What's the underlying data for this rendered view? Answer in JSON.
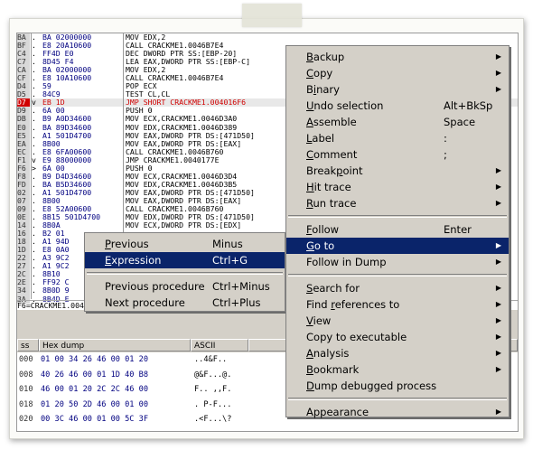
{
  "disassembly": {
    "rows": [
      {
        "addr": "BA",
        "mark": ".",
        "hex": "BA 02000000",
        "asm": "MOV EDX,2"
      },
      {
        "addr": "BF",
        "mark": ".",
        "hex": "E8 20A10600",
        "asm": "CALL CRACKME1.0046B7E4"
      },
      {
        "addr": "C4",
        "mark": ".",
        "hex": "FF4D E0",
        "asm": "DEC DWORD PTR SS:[EBP-20]"
      },
      {
        "addr": "C7",
        "mark": ".",
        "hex": "8D45 F4",
        "asm": "LEA EAX,DWORD PTR SS:[EBP-C]"
      },
      {
        "addr": "CA",
        "mark": ".",
        "hex": "BA 02000000",
        "asm": "MOV EDX,2"
      },
      {
        "addr": "CF",
        "mark": ".",
        "hex": "E8 10A10600",
        "asm": "CALL CRACKME1.0046B7E4"
      },
      {
        "addr": "D4",
        "mark": ".",
        "hex": "59",
        "asm": "POP ECX"
      },
      {
        "addr": "D5",
        "mark": ".",
        "hex": "84C9",
        "asm": "TEST CL,CL"
      },
      {
        "addr": "D7",
        "mark": "v",
        "hex": "EB 1D",
        "asm": "JMP SHORT CRACKME1.004016F6",
        "selected": true
      },
      {
        "addr": "D9",
        "mark": ".",
        "hex": "6A 00",
        "asm": "PUSH 0"
      },
      {
        "addr": "DB",
        "mark": ".",
        "hex": "B9 A0D34600",
        "asm": "MOV ECX,CRACKME1.0046D3A0"
      },
      {
        "addr": "E0",
        "mark": ".",
        "hex": "BA 89D34600",
        "asm": "MOV EDX,CRACKME1.0046D389"
      },
      {
        "addr": "E5",
        "mark": ".",
        "hex": "A1 501D4700",
        "asm": "MOV EAX,DWORD PTR DS:[471D50]"
      },
      {
        "addr": "EA",
        "mark": ".",
        "hex": "8B00",
        "asm": "MOV EAX,DWORD PTR DS:[EAX]"
      },
      {
        "addr": "EC",
        "mark": ".",
        "hex": "E8 6FA00600",
        "asm": "CALL CRACKME1.0046B760"
      },
      {
        "addr": "F1",
        "mark": "v",
        "hex": "E9 88000000",
        "asm": "JMP CRACKME1.0040177E"
      },
      {
        "addr": "F6",
        "mark": ">",
        "hex": "6A 00",
        "asm": "PUSH 0"
      },
      {
        "addr": "F8",
        "mark": ".",
        "hex": "B9 D4D34600",
        "asm": "MOV ECX,CRACKME1.0046D3D4"
      },
      {
        "addr": "FD",
        "mark": ".",
        "hex": "BA B5D34600",
        "asm": "MOV EDX,CRACKME1.0046D3B5"
      },
      {
        "addr": "02",
        "mark": ".",
        "hex": "A1 501D4700",
        "asm": "MOV EAX,DWORD PTR DS:[471D50]"
      },
      {
        "addr": "07",
        "mark": ".",
        "hex": "8B00",
        "asm": "MOV EAX,DWORD PTR DS:[EAX]"
      },
      {
        "addr": "09",
        "mark": ".",
        "hex": "E8 52A00600",
        "asm": "CALL CRACKME1.0046B760"
      },
      {
        "addr": "0E",
        "mark": ".",
        "hex": "8B15 501D4700",
        "asm": "MOV EDX,DWORD PTR DS:[471D50]"
      },
      {
        "addr": "14",
        "mark": ".",
        "hex": "8B0A",
        "asm": "MOV ECX,DWORD PTR DS:[EDX]"
      },
      {
        "addr": "16",
        "mark": ".",
        "hex": "B2 01",
        "asm": ""
      },
      {
        "addr": "18",
        "mark": ".",
        "hex": "A1 94D",
        "asm": ""
      },
      {
        "addr": "1D",
        "mark": ".",
        "hex": "E8 0A0",
        "asm": ""
      },
      {
        "addr": "22",
        "mark": ".",
        "hex": "A3 9C2",
        "asm": ""
      },
      {
        "addr": "27",
        "mark": ".",
        "hex": "A1 9C2",
        "asm": ""
      },
      {
        "addr": "2C",
        "mark": ".",
        "hex": "8B10",
        "asm": ""
      },
      {
        "addr": "2E",
        "mark": ".",
        "hex": "FF92 C",
        "asm": ""
      },
      {
        "addr": "34",
        "mark": ".",
        "hex": "8B0D 9",
        "asm": ""
      },
      {
        "addr": "3A",
        "mark": ".",
        "hex": "8B4D E",
        "asm": ""
      }
    ],
    "status_line": "F6=CRACKME1.004016F6"
  },
  "dump": {
    "headers": {
      "addr": "ss",
      "hex": "Hex dump",
      "ascii": "ASCII"
    },
    "rows": [
      {
        "addr": "000",
        "hex": "01 00 34 26 46 00 01 20",
        "ascii": "..4&F.. "
      },
      {
        "addr": "008",
        "hex": "40 26 46 00 01 1D 40 B8",
        "ascii": "@&F...@."
      },
      {
        "addr": "010",
        "hex": "46 00 01 20 2C 2C 46 00",
        "ascii": "F.. ,,F."
      },
      {
        "addr": "018",
        "hex": "01 20 50 2D 46 00 01 00",
        "ascii": ". P-F..."
      },
      {
        "addr": "020",
        "hex": "00 3C 46 00 01 00 5C 3F",
        "ascii": ".<F...\\?"
      }
    ]
  },
  "context_menu": {
    "items": [
      {
        "name": "backup",
        "label": "Backup",
        "u": "B",
        "submenu": true
      },
      {
        "name": "copy",
        "label": "Copy",
        "u": "C",
        "submenu": true
      },
      {
        "name": "binary",
        "label": "Binary",
        "u": "i",
        "submenu": true
      },
      {
        "name": "undo-selection",
        "label": "Undo selection",
        "u": "U",
        "shortcut": "Alt+BkSp"
      },
      {
        "name": "assemble",
        "label": "Assemble",
        "u": "A",
        "shortcut": "Space"
      },
      {
        "name": "label",
        "label": "Label",
        "u": "L",
        "shortcut": ":"
      },
      {
        "name": "comment",
        "label": "Comment",
        "u": "C",
        "shortcut": ";"
      },
      {
        "name": "breakpoint",
        "label": "Breakpoint",
        "u": "p",
        "submenu": true
      },
      {
        "name": "hit-trace",
        "label": "Hit trace",
        "u": "H",
        "submenu": true
      },
      {
        "name": "run-trace",
        "label": "Run trace",
        "u": "R",
        "submenu": true
      },
      {
        "sep": true
      },
      {
        "name": "follow",
        "label": "Follow",
        "u": "F",
        "shortcut": "Enter"
      },
      {
        "name": "go-to",
        "label": "Go to",
        "u": "G",
        "submenu": true,
        "highlight": true
      },
      {
        "name": "follow-in-dump",
        "label": "Follow in Dump",
        "submenu": true
      },
      {
        "sep": true
      },
      {
        "name": "search-for",
        "label": "Search for",
        "u": "S",
        "submenu": true
      },
      {
        "name": "find-references-to",
        "label": "Find references to",
        "u": "r",
        "submenu": true
      },
      {
        "name": "view",
        "label": "View",
        "u": "V",
        "submenu": true
      },
      {
        "name": "copy-to-executable",
        "label": "Copy to executable",
        "submenu": true
      },
      {
        "name": "analysis",
        "label": "Analysis",
        "u": "A",
        "submenu": true
      },
      {
        "name": "bookmark",
        "label": "Bookmark",
        "u": "B",
        "submenu": true
      },
      {
        "name": "dump-debugged-process",
        "label": "Dump debugged process",
        "u": "D"
      },
      {
        "sep": true
      },
      {
        "name": "appearance",
        "label": "Appearance",
        "submenu": true
      }
    ]
  },
  "goto_submenu": {
    "items": [
      {
        "name": "previous",
        "label": "Previous",
        "u": "P",
        "shortcut": "Minus"
      },
      {
        "name": "expression",
        "label": "Expression",
        "u": "E",
        "shortcut": "Ctrl+G",
        "highlight": true
      },
      {
        "sep": true
      },
      {
        "name": "previous-procedure",
        "label": "Previous procedure",
        "shortcut": "Ctrl+Minus"
      },
      {
        "name": "next-procedure",
        "label": "Next procedure",
        "shortcut": "Ctrl+Plus"
      }
    ]
  },
  "colors": {
    "menu_bg": "#d4d0c8",
    "highlight": "#0a246a",
    "jump_red": "#d00000"
  }
}
